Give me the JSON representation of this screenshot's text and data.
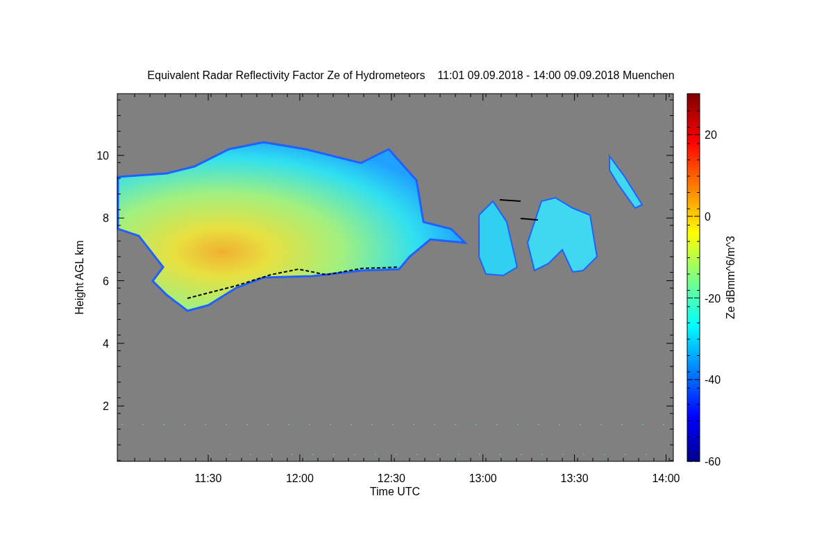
{
  "title": "Equivalent Radar Reflectivity Factor Ze of Hydrometeors    11:01 09.09.2018 - 14:00 09.09.2018 Muenchen",
  "y_axis": {
    "label": "Height AGL km",
    "ticks": [
      "10",
      "8",
      "6",
      "4",
      "2"
    ]
  },
  "x_axis": {
    "label": "Time UTC",
    "ticks": [
      "11:30",
      "12:00",
      "12:30",
      "13:00",
      "13:30",
      "14:00"
    ]
  },
  "colorbar": {
    "label": "Ze dBmm^6/m^3",
    "ticks": [
      "20",
      "0",
      "-20",
      "-40",
      "-60"
    ]
  }
}
